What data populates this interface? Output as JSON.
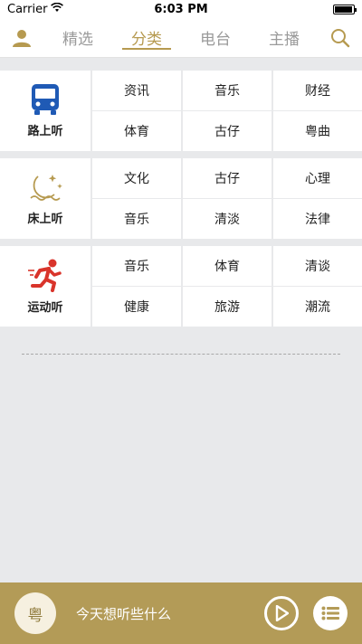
{
  "status": {
    "carrier": "Carrier",
    "time": "6:03 PM"
  },
  "nav": {
    "tabs": [
      {
        "label": "精选",
        "active": false
      },
      {
        "label": "分类",
        "active": true
      },
      {
        "label": "电台",
        "active": false
      },
      {
        "label": "主播",
        "active": false
      }
    ]
  },
  "sections": [
    {
      "label": "路上听",
      "icon": "bus-icon",
      "items": [
        "资讯",
        "音乐",
        "财经",
        "体育",
        "古仔",
        "粤曲"
      ]
    },
    {
      "label": "床上听",
      "icon": "moon-icon",
      "items": [
        "文化",
        "古仔",
        "心理",
        "音乐",
        "清淡",
        "法律"
      ]
    },
    {
      "label": "运动听",
      "icon": "runner-icon",
      "items": [
        "音乐",
        "体育",
        "清谈",
        "健康",
        "旅游",
        "潮流"
      ]
    }
  ],
  "player": {
    "avatar_text": "粤",
    "prompt": "今天想听些什么"
  },
  "colors": {
    "accent": "#b69a50",
    "player_bg": "#b39b57",
    "bus_blue": "#1f5ab5",
    "runner_red": "#d9342b"
  }
}
